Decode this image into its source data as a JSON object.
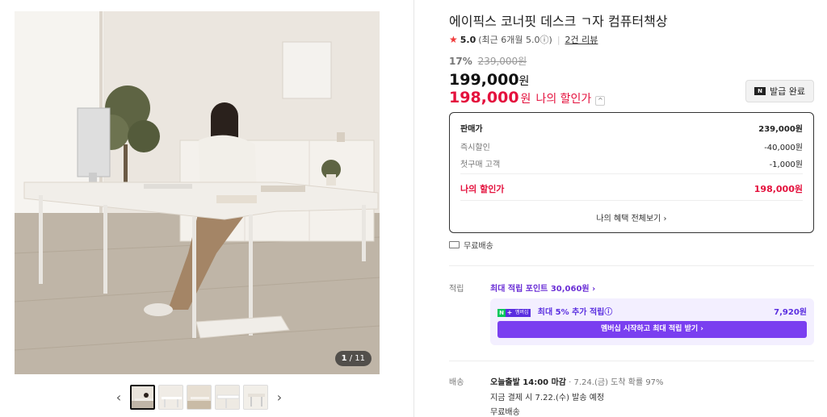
{
  "gallery": {
    "counter_current": "1",
    "counter_total": "/ 11",
    "prev_icon": "‹",
    "next_icon": "›",
    "thumbnail_count": 5
  },
  "product": {
    "title": "에이픽스 코너핏 데스크 ㄱ자 컴퓨터책상",
    "rating_score": "5.0",
    "rating_note": "(최근 6개월 5.0ⓘ)",
    "review_link": "2건 리뷰",
    "discount_rate": "17%",
    "original_price": "239,000원",
    "price": "199,000",
    "price_unit": "원",
    "my_price": "198,000",
    "my_price_unit": "원",
    "my_price_label": "나의 할인가",
    "my_price_toggle": "^"
  },
  "coupon": {
    "icon_text": "N",
    "label": "발급 완료"
  },
  "price_breakdown": {
    "rows": [
      {
        "label": "판매가",
        "value": "239,000원"
      },
      {
        "label": "즉시할인",
        "value": "-40,000원"
      },
      {
        "label": "첫구매 고객",
        "value": "-1,000원"
      },
      {
        "label": "나의 할인가",
        "value": "198,000원"
      }
    ],
    "benefit_link": "나의 혜택 전체보기 ›"
  },
  "shipping_free": "무료배송",
  "points": {
    "label": "적립",
    "max_points": "최대 적립 포인트 30,060원 ›",
    "membership_badge_n": "N",
    "membership_badge_plus": "+",
    "membership_badge_text": "멤버십",
    "membership_text": "최대 5% 추가 적립ⓘ",
    "membership_value": "7,920원",
    "membership_button": "멤버십 시작하고 최대 적립 받기 ›"
  },
  "delivery": {
    "label": "배송",
    "cutoff": "오늘출발 14:00 마감",
    "arrival": " · 7.24.(금) 도착 확률 97%",
    "dispatch": "지금 결제 시 7.22.(수) 발송 예정",
    "fee": "무료배송"
  },
  "colors": {
    "accent_red": "#e4113d",
    "membership_purple": "#7a3ff0",
    "naver_green": "#03c75a"
  }
}
